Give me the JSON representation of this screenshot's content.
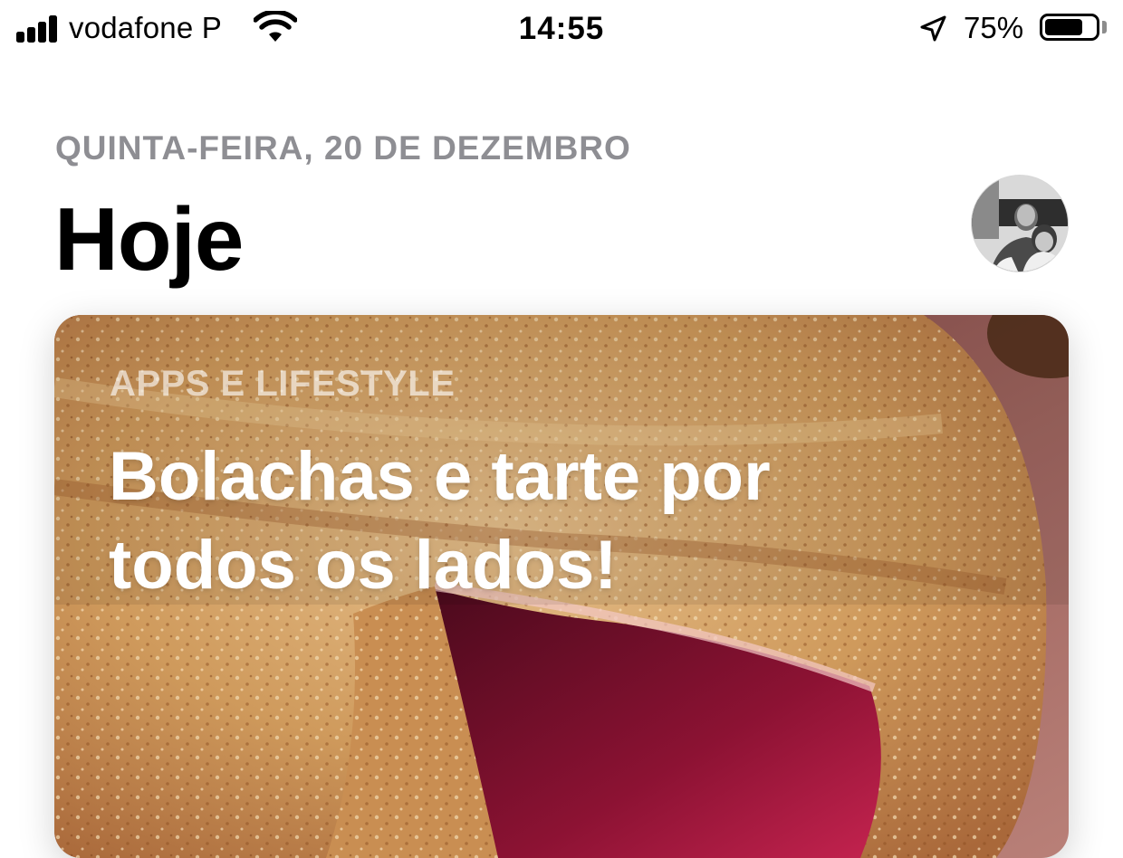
{
  "status_bar": {
    "carrier": "vodafone P",
    "time": "14:55",
    "battery_percent": "75%",
    "battery_level": 0.75,
    "icons": [
      "signal-bars-icon",
      "wifi-icon",
      "location-arrow-icon",
      "battery-icon"
    ]
  },
  "header": {
    "date": "QUINTA-FEIRA, 20 DE DEZEMBRO",
    "title": "Hoje"
  },
  "featured_card": {
    "category": "APPS E LIFESTYLE",
    "title": "Bolachas e tarte por todos os lados!"
  },
  "colors": {
    "date_gray": "#8e8e93",
    "text": "#000000",
    "card_text": "#ffffff"
  }
}
